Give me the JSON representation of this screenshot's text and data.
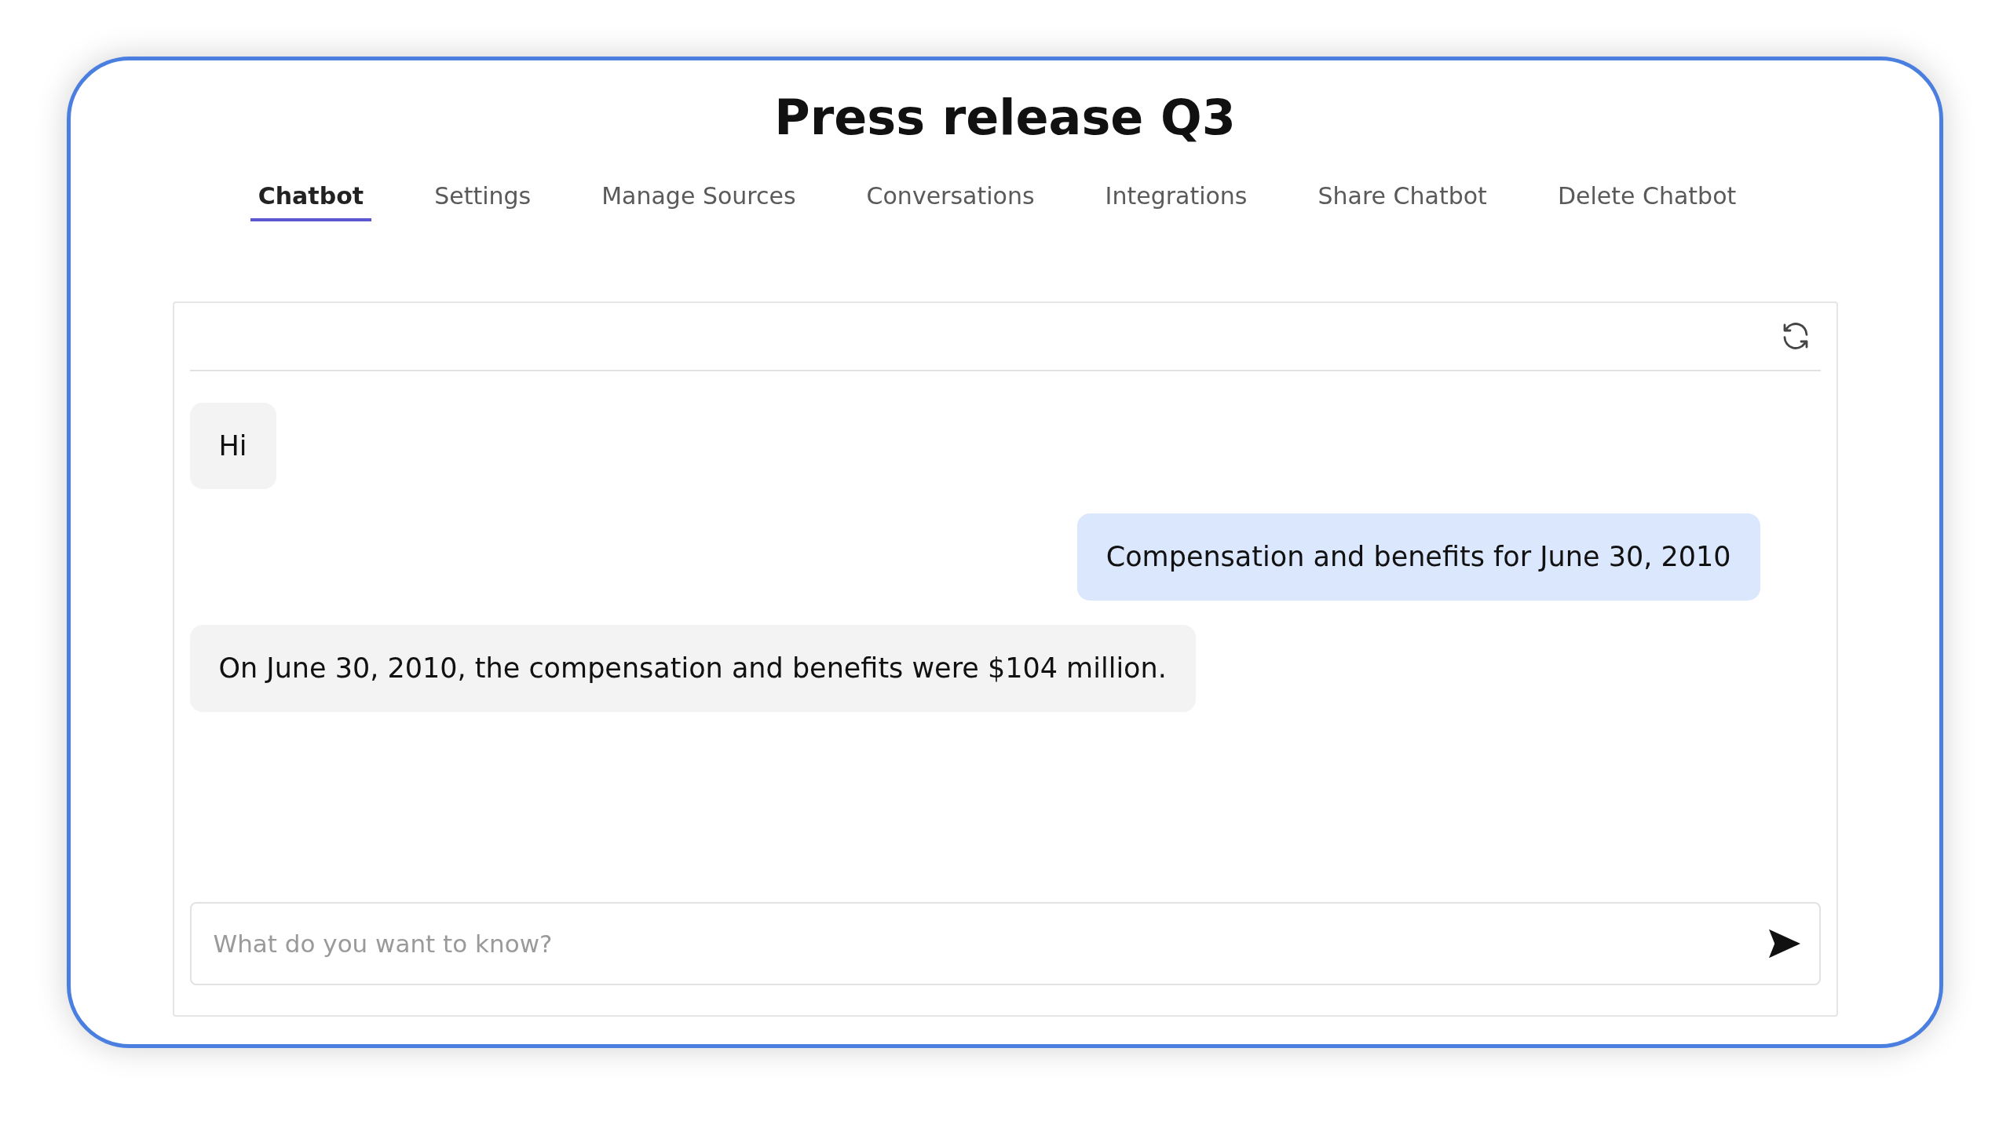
{
  "title": "Press release Q3",
  "tabs": [
    {
      "label": "Chatbot",
      "selected": true
    },
    {
      "label": "Settings",
      "selected": false
    },
    {
      "label": "Manage Sources",
      "selected": false
    },
    {
      "label": "Conversations",
      "selected": false
    },
    {
      "label": "Integrations",
      "selected": false
    },
    {
      "label": "Share Chatbot",
      "selected": false
    },
    {
      "label": "Delete Chatbot",
      "selected": false
    }
  ],
  "messages": [
    {
      "kind": "bot",
      "text": "Hi"
    },
    {
      "kind": "user",
      "text": "Compensation and benefits for June 30, 2010"
    },
    {
      "kind": "bot",
      "text": "On June 30, 2010, the compensation and benefits were $104 million."
    }
  ],
  "input": {
    "placeholder": "What do you want to know?"
  }
}
